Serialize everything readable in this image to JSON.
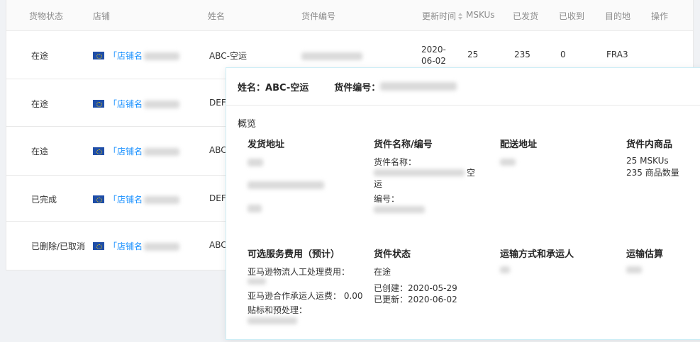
{
  "table": {
    "headers": {
      "status": "货物状态",
      "store": "店铺",
      "name": "姓名",
      "shipment_id": "货件编号",
      "updated": "更新时间",
      "mskus": "MSKUs",
      "shipped": "已发货",
      "received": "已收到",
      "destination": "目的地",
      "actions": "操作"
    },
    "rows": [
      {
        "status": "在途",
        "store": "「店铺名",
        "name": "ABC-空运",
        "updated": "2020-06-02",
        "mskus": "25",
        "shipped": "235",
        "received": "0",
        "destination": "FRA3"
      },
      {
        "status": "在途",
        "store": "「店铺名",
        "name": "DEF-"
      },
      {
        "status": "在途",
        "store": "「店铺名",
        "name": "ABC-"
      },
      {
        "status": "已完成",
        "store": "「店铺名",
        "name": "DEF-"
      },
      {
        "status": "已删除/已取消",
        "store": "「店铺名",
        "name": "ABC-"
      }
    ]
  },
  "popover": {
    "name_label": "姓名：",
    "name_value": "ABC-空运",
    "shipment_label": "货件编号：",
    "section": "概览",
    "ship_from": {
      "title": "发货地址"
    },
    "shipment_name": {
      "title": "货件名称/编号",
      "name_label": "货件名称：",
      "name_suffix": "空",
      "name_line2": "运",
      "id_label": "编号："
    },
    "ship_to": {
      "title": "配送地址"
    },
    "contents": {
      "title": "货件内商品",
      "line1": "25 MSKUs",
      "line2": "235 商品数量"
    },
    "fees": {
      "title": "可选服务费用（预计）",
      "labor_label": "亚马逊物流人工处理费用：",
      "carrier_label": "亚马逊合作承运人运费：",
      "carrier_value": "0.00",
      "prep_label": "贴标和预处理："
    },
    "status": {
      "title": "货件状态",
      "value": "在途",
      "created_label": "已创建：",
      "created": "2020-05-29",
      "updated_label": "已更新：",
      "updated": "2020-06-02"
    },
    "shipping": {
      "title": "运输方式和承运人"
    },
    "estimate": {
      "title": "运输估算"
    }
  }
}
